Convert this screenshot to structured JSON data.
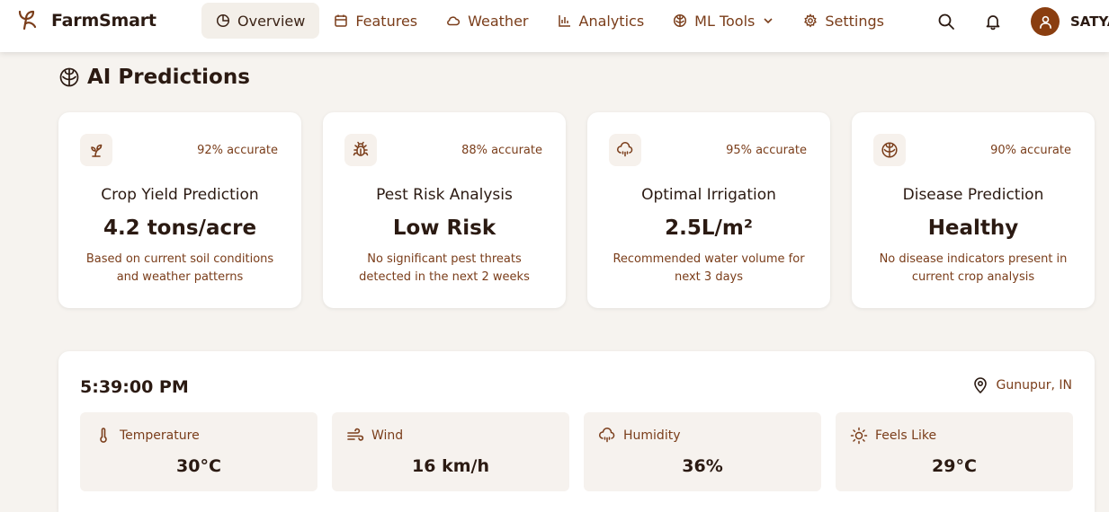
{
  "app": {
    "name": "FarmSmart",
    "logo_icon": "sprout-logo-icon"
  },
  "nav": {
    "items": [
      {
        "label": "Overview",
        "icon": "pie-chart-icon",
        "active": true
      },
      {
        "label": "Features",
        "icon": "calendar-icon"
      },
      {
        "label": "Weather",
        "icon": "cloud-icon"
      },
      {
        "label": "Analytics",
        "icon": "bar-chart-icon"
      },
      {
        "label": "ML Tools",
        "icon": "brain-icon",
        "dropdown": true
      },
      {
        "label": "Settings",
        "icon": "gear-icon"
      }
    ]
  },
  "user": {
    "name": "SATYA"
  },
  "predictions": {
    "title": "AI Predictions",
    "cards": [
      {
        "icon": "sprout-icon",
        "accuracy": "92% accurate",
        "title": "Crop Yield Prediction",
        "value": "4.2 tons/acre",
        "description": "Based on current soil conditions and weather patterns"
      },
      {
        "icon": "bug-icon",
        "accuracy": "88% accurate",
        "title": "Pest Risk Analysis",
        "value": "Low Risk",
        "description": "No significant pest threats detected in the next 2 weeks"
      },
      {
        "icon": "cloud-rain-icon",
        "accuracy": "95% accurate",
        "title": "Optimal Irrigation",
        "value": "2.5L/m²",
        "description": "Recommended water volume for next 3 days"
      },
      {
        "icon": "brain-icon",
        "accuracy": "90% accurate",
        "title": "Disease Prediction",
        "value": "Healthy",
        "description": "No disease indicators present in current crop analysis"
      }
    ]
  },
  "weather": {
    "time": "5:39:00 PM",
    "location": "Gunupur, IN",
    "metrics": [
      {
        "icon": "thermometer-icon",
        "label": "Temperature",
        "value": "30°C"
      },
      {
        "icon": "wind-icon",
        "label": "Wind",
        "value": "16 km/h"
      },
      {
        "icon": "cloud-rain-icon",
        "label": "Humidity",
        "value": "36%"
      },
      {
        "icon": "sun-icon",
        "label": "Feels Like",
        "value": "29°C"
      }
    ]
  },
  "colors": {
    "brand_brown": "#7a3d1a",
    "avatar_bg": "#8a3e10",
    "page_bg": "#f6f3ef"
  }
}
